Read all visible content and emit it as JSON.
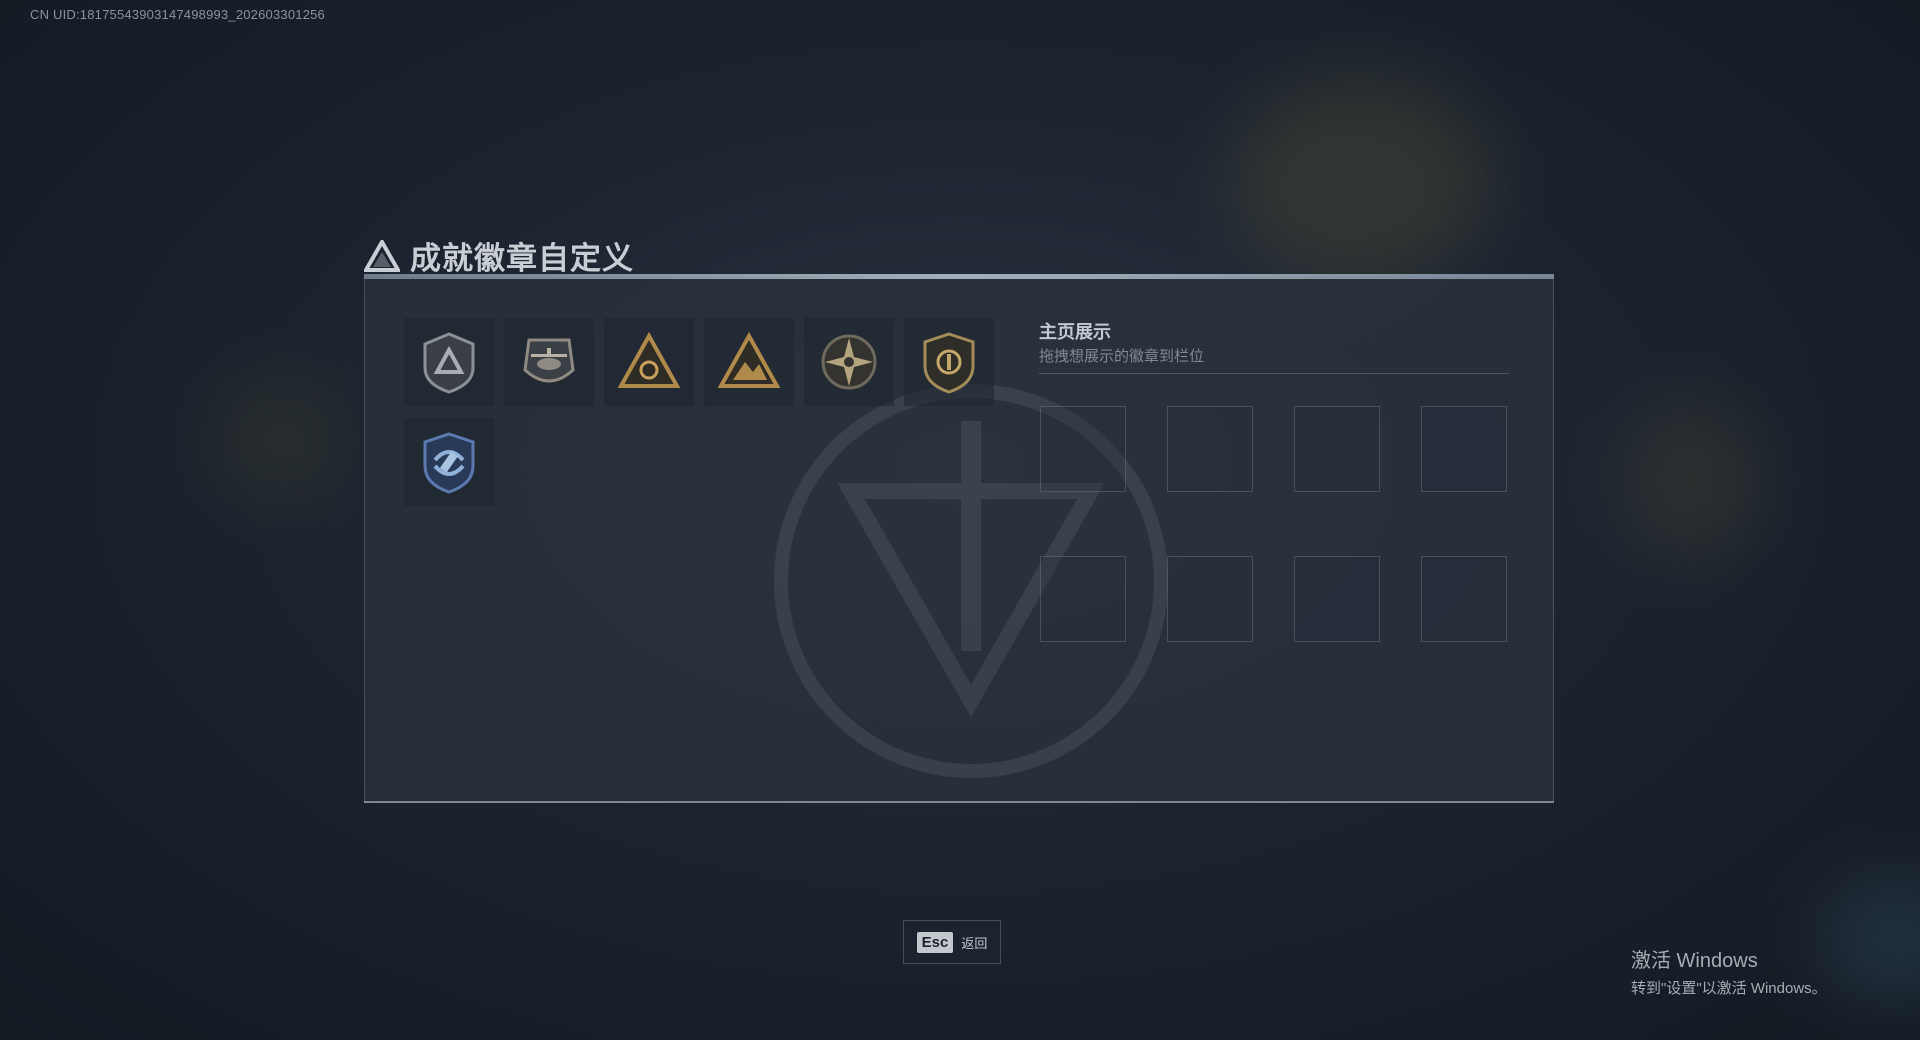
{
  "uid_text": "CN UID:18175543903147498993_202603301256",
  "dialog": {
    "title": "成就徽章自定义",
    "title_icon": "triangle-emblem-icon"
  },
  "badges": [
    {
      "name": "shield-triangle-badge",
      "tint": "#8b8f96"
    },
    {
      "name": "helicopter-badge",
      "tint": "#8f8b82"
    },
    {
      "name": "gold-triangle-badge",
      "tint": "#b08a4a"
    },
    {
      "name": "gold-mountain-triangle-badge",
      "tint": "#b08a4a"
    },
    {
      "name": "star-compass-badge",
      "tint": "#b3a37e"
    },
    {
      "name": "gold-shield-badge",
      "tint": "#a48c5a"
    },
    {
      "name": "blue-shield-badge",
      "tint": "#5b7bb0"
    }
  ],
  "showcase": {
    "title": "主页展示",
    "subtitle": "拖拽想展示的徽章到栏位",
    "slot_count": 8
  },
  "footer": {
    "esc_key": "Esc",
    "esc_label": "返回"
  },
  "windows_activation": {
    "line1": "激活 Windows",
    "line2": "转到\"设置\"以激活 Windows。"
  }
}
